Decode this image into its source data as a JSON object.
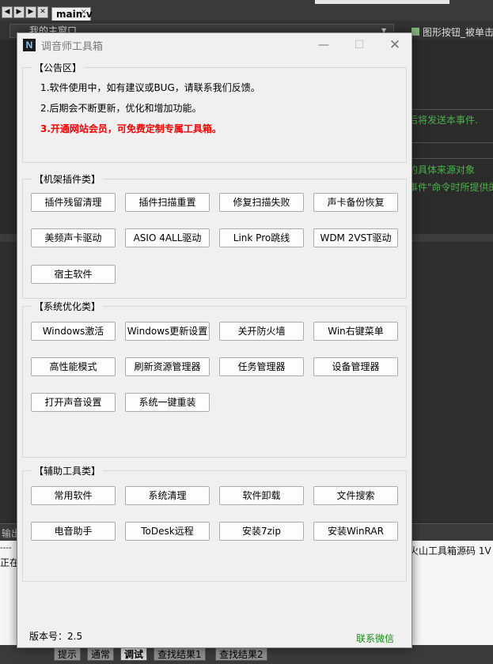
{
  "ide": {
    "tab": "main.v",
    "combo": "我的主窗口",
    "right_label": "图形按钮_被单击",
    "code_lines": [
      "后将发送本事件.",
      "的具体来源对象",
      "事件\"命令时所提供的"
    ],
    "output_lines": [
      "火山工具箱源码 1V",
      "正在"
    ],
    "output_head": "输出",
    "bottom_tabs": [
      "提示",
      "通常",
      "调试",
      "查找结果1",
      "查找结果2"
    ],
    "dash_row": "----"
  },
  "window": {
    "title": "调音师工具箱",
    "logo": "N",
    "minimize": "—",
    "maximize": "☐",
    "close": "✕"
  },
  "notice": {
    "title": "【公告区】",
    "lines": [
      "1.软件使用中，如有建议或BUG，请联系我们反馈。",
      "2.后期会不断更新，优化和增加功能。",
      "3.开通网站会员，可免费定制专属工具箱。"
    ]
  },
  "plugins": {
    "title": "【机架插件类】",
    "buttons": [
      "插件残留清理",
      "插件扫描重置",
      "修复扫描失败",
      "声卡备份恢复",
      "美频声卡驱动",
      "ASIO 4ALL驱动",
      "Link Pro跳线",
      "WDM 2VST驱动",
      "宿主软件"
    ]
  },
  "system": {
    "title": "【系统优化类】",
    "buttons": [
      "Windows激活",
      "Windows更新设置",
      "关开防火墙",
      "Win右键菜单",
      "高性能模式",
      "刷新资源管理器",
      "任务管理器",
      "设备管理器",
      "打开声音设置",
      "系统一键重装"
    ]
  },
  "tools": {
    "title": "【辅助工具类】",
    "buttons": [
      "常用软件",
      "系统清理",
      "软件卸载",
      "文件搜索",
      "电音助手",
      "ToDesk远程",
      "安装7zip",
      "安装WinRAR"
    ]
  },
  "footer": {
    "version": "版本号：2.5",
    "contact": "联系微信"
  }
}
